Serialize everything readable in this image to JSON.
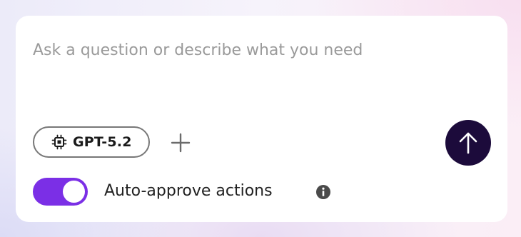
{
  "composer": {
    "placeholder": "Ask a question or describe what you need",
    "value": ""
  },
  "model": {
    "label": "GPT-5.2",
    "icon": "chip-icon"
  },
  "actions": {
    "add_icon": "plus-icon",
    "send_icon": "arrow-up-icon"
  },
  "auto_approve": {
    "label": "Auto-approve actions",
    "enabled": true,
    "info_icon": "info-icon"
  },
  "colors": {
    "toggle_on": "#7b2fe6",
    "send_button": "#1c0b3b",
    "chip_border": "#777777"
  }
}
